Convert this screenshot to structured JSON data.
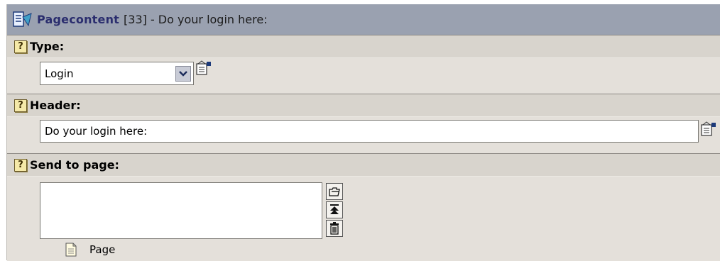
{
  "title": {
    "link": "Pagecontent",
    "rest": "[33] - Do your login here:"
  },
  "fields": {
    "type": {
      "label": "Type:",
      "value": "Login"
    },
    "header": {
      "label": "Header:",
      "value": "Do your login here:"
    },
    "send_to_page": {
      "label": "Send to page:",
      "value": "",
      "item_label": "Page"
    }
  },
  "help_glyph": "?",
  "icons": {
    "title": "page-content-icon",
    "help": "help-icon",
    "wizard": "edit-wizard-icon",
    "browse": "browse-folder-icon",
    "move_up": "move-to-top-icon",
    "delete": "trash-icon",
    "page": "page-document-icon"
  }
}
